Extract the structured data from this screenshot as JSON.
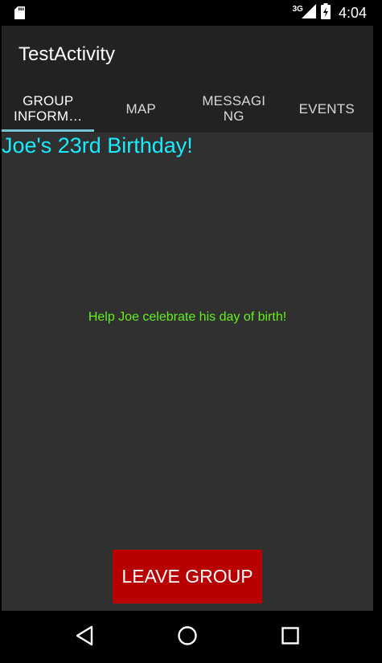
{
  "status_bar": {
    "network": "3G",
    "time": "4:04",
    "icons": [
      "sd-card-icon",
      "signal-icon",
      "battery-charging-icon"
    ]
  },
  "action_bar": {
    "title": "TestActivity"
  },
  "tabs": [
    {
      "label": "GROUP\nINFORM…",
      "active": true
    },
    {
      "label": "MAP",
      "active": false
    },
    {
      "label": "MESSAGI\nNG",
      "active": false
    },
    {
      "label": "EVENTS",
      "active": false
    }
  ],
  "group": {
    "title": "Joe's 23rd Birthday!",
    "description": "Help Joe celebrate his day of birth!"
  },
  "leave_button": {
    "label": "LEAVE GROUP"
  },
  "nav_bar": {
    "icons": [
      "back-icon",
      "home-icon",
      "recents-icon"
    ]
  },
  "colors": {
    "accent": "#74c6d6",
    "title": "#18ecff",
    "description": "#64f01c",
    "button": "#b90000",
    "background": "#303030",
    "bars": "#222222"
  }
}
